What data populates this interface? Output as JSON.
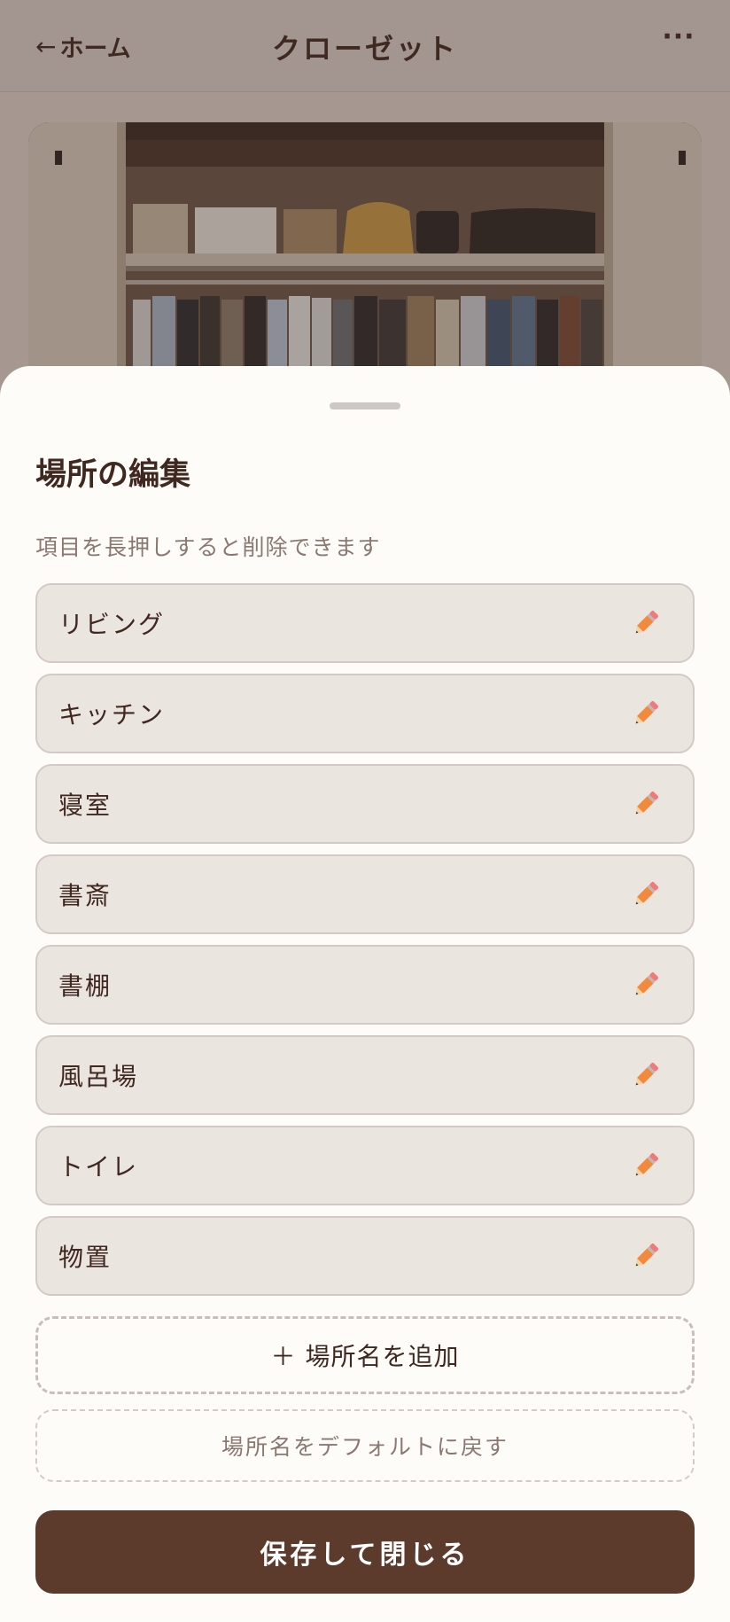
{
  "header": {
    "back_arrow": "←",
    "back_label": "ホーム",
    "title": "クローゼット",
    "more_label": "···"
  },
  "photo": {
    "description_icon": "closet-photo"
  },
  "sheet": {
    "title": "場所の編集",
    "hint": "項目を長押しすると削除できます",
    "items": [
      {
        "label": "リビング"
      },
      {
        "label": "キッチン"
      },
      {
        "label": "寝室"
      },
      {
        "label": "書斎"
      },
      {
        "label": "書棚"
      },
      {
        "label": "風呂場"
      },
      {
        "label": "トイレ"
      },
      {
        "label": "物置"
      }
    ],
    "add_label": "＋ 場所名を追加",
    "reset_label": "場所名をデフォルトに戻す",
    "save_label": "保存して閉じる"
  },
  "colors": {
    "accent": "#5c3a2c",
    "text": "#40271f",
    "item_bg": "#ebe5e0",
    "overlay": "#a39690"
  },
  "icons": {
    "item_edit": "pencil-icon"
  }
}
